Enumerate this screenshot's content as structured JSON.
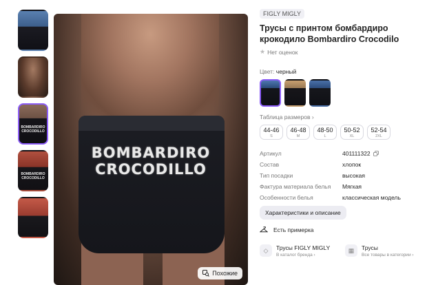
{
  "thumbnails": [
    {
      "label": ""
    },
    {
      "label": ""
    },
    {
      "label": "BOMBARDIRO\nCROCODILLO"
    },
    {
      "label": "BOMBARDIRO\nCROCODILLO"
    },
    {
      "label": ""
    }
  ],
  "main_image": {
    "print_line1": "BOMBARDIRO",
    "print_line2": "CROCODILLO",
    "similar_label": "Похожие"
  },
  "product": {
    "brand": "FIGLY MIGLY",
    "title": "Трусы с принтом бомбардиро крокодило Bombardiro Crocodilo",
    "rating_text": "Нет оценок",
    "color_label": "Цвет:",
    "color_value": "черный",
    "size_table_label": "Таблица размеров",
    "sizes": [
      {
        "ru": "44-46",
        "intl": "S"
      },
      {
        "ru": "46-48",
        "intl": "M"
      },
      {
        "ru": "48-50",
        "intl": "L"
      },
      {
        "ru": "50-52",
        "intl": "XL"
      },
      {
        "ru": "52-54",
        "intl": "2XL"
      }
    ],
    "specs": [
      {
        "key": "Артикул",
        "value": "401111322"
      },
      {
        "key": "Состав",
        "value": "хлопок"
      },
      {
        "key": "Тип посадки",
        "value": "высокая"
      },
      {
        "key": "Фактура материала белья",
        "value": "Мягкая"
      },
      {
        "key": "Особенности белья",
        "value": "классическая модель"
      }
    ],
    "characteristics_button": "Характеристики и описание",
    "fitting_label": "Есть примерка"
  },
  "links": [
    {
      "title": "Трусы FIGLY MIGLY",
      "subtitle": "В каталог бренда"
    },
    {
      "title": "Трусы",
      "subtitle": "Все товары в категории"
    }
  ],
  "colors": {
    "accent": "#8b5cf6",
    "text": "#242424",
    "muted": "#777777"
  }
}
